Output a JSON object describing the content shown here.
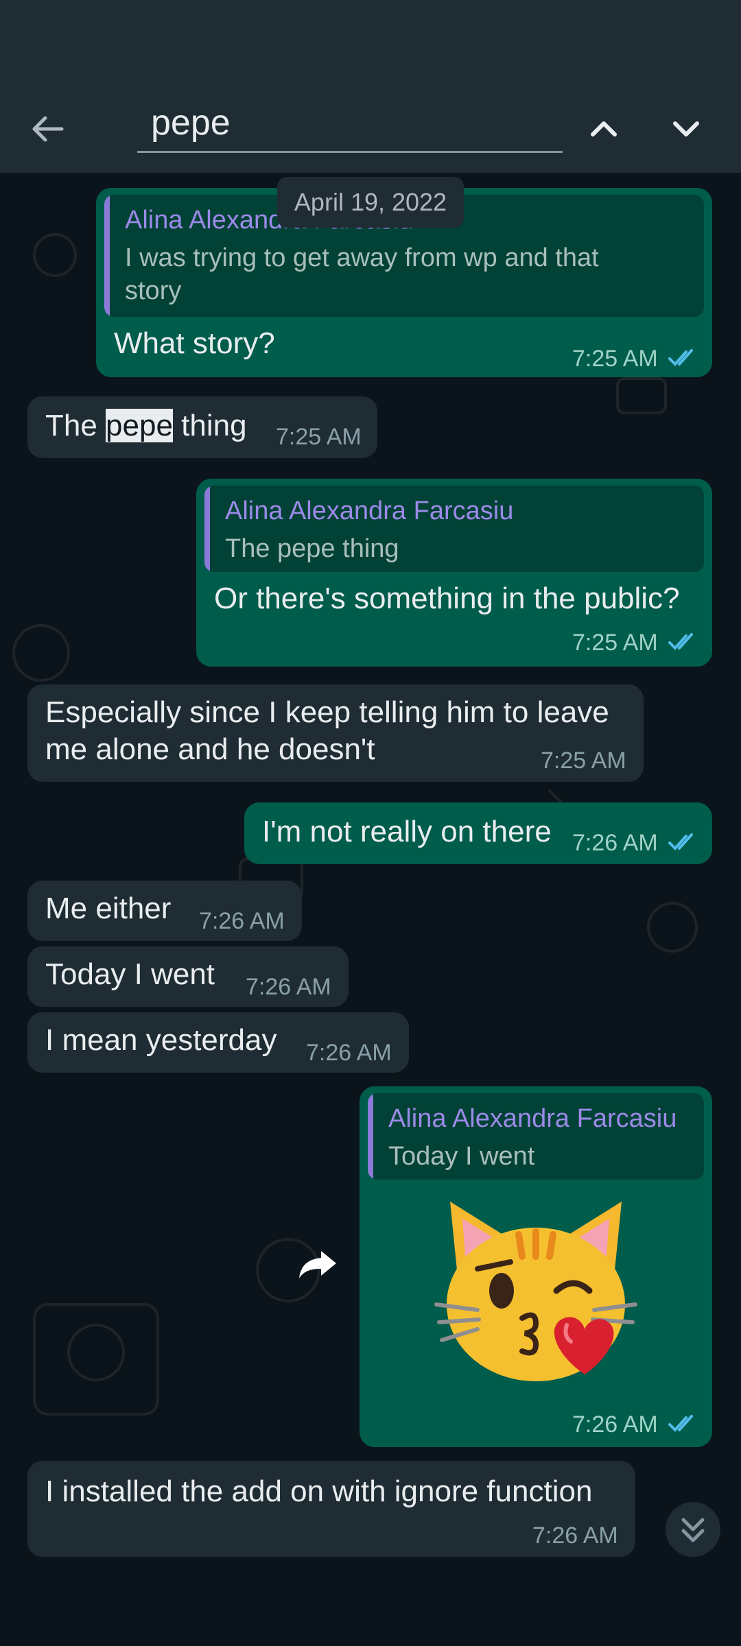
{
  "search": {
    "query": "pepe"
  },
  "date_chip": "April 19, 2022",
  "messages": [
    {
      "quote_name": "Alina Alexandra Farcasiu",
      "quote_text": "I was trying to get away from wp and that story",
      "text": "What story?",
      "time": "7:25 AM"
    },
    {
      "text_before": "The ",
      "highlight": "pepe",
      "text_after": " thing",
      "time": "7:25 AM"
    },
    {
      "quote_name": "Alina Alexandra Farcasiu",
      "quote_text": "The pepe thing",
      "text": "Or there's something in the public?",
      "time": "7:25 AM"
    },
    {
      "line1": "Especially since I keep telling him to leave",
      "line2": "me alone and he doesn't",
      "time": "7:25 AM"
    },
    {
      "text": "I'm not really on there",
      "time": "7:26 AM"
    },
    {
      "text": "Me either",
      "time": "7:26 AM"
    },
    {
      "text": "Today I went",
      "time": "7:26 AM"
    },
    {
      "text": "I mean yesterday",
      "time": "7:26 AM"
    },
    {
      "quote_name": "Alina Alexandra Farcasiu",
      "quote_text": "Today I went",
      "sticker": "cat-kiss-emoji",
      "time": "7:26 AM"
    },
    {
      "text": "I installed the add on with ignore function",
      "time": "7:26 AM"
    }
  ],
  "colors": {
    "outgoing": "#005c4b",
    "incoming": "#1f2c34",
    "read_ticks": "#53bdeb",
    "quote_name": "#9b8ae8"
  },
  "icons": [
    "back-arrow-icon",
    "chevron-up-icon",
    "chevron-down-icon",
    "forward-icon",
    "double-chevron-down-icon",
    "double-check-icon"
  ]
}
